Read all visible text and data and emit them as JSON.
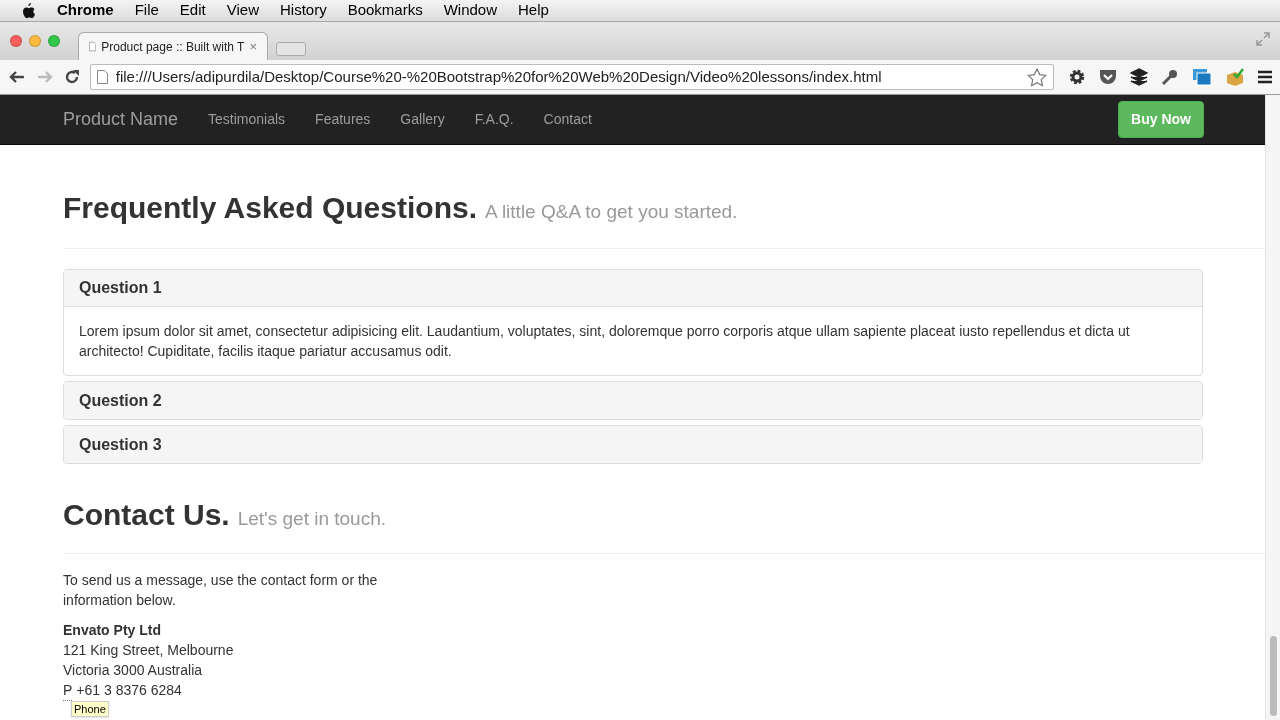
{
  "menu_bar": {
    "app": "Chrome",
    "items": [
      "File",
      "Edit",
      "View",
      "History",
      "Bookmarks",
      "Window",
      "Help"
    ]
  },
  "tabs": [
    {
      "title": "Product page :: Built with T",
      "selected": true,
      "close": "×"
    }
  ],
  "address_bar": {
    "value": "file:///Users/adipurdila/Desktop/Course%20-%20Bootstrap%20for%20Web%20Design/Video%20lessons/index.html"
  },
  "navbar": {
    "brand": "Product Name",
    "links": [
      "Testimonials",
      "Features",
      "Gallery",
      "F.A.Q.",
      "Contact"
    ],
    "cta": "Buy Now"
  },
  "faq": {
    "title": "Frequently Asked Questions.",
    "subtitle": "A little Q&A to get you started.",
    "panels": [
      {
        "question": "Question 1",
        "expanded": true,
        "answer": "Lorem ipsum dolor sit amet, consectetur adipisicing elit. Laudantium, voluptates, sint, doloremque porro corporis atque ullam sapiente placeat iusto repellendus et dicta ut architecto! Cupiditate, facilis itaque pariatur accusamus odit."
      },
      {
        "question": "Question 2",
        "expanded": false
      },
      {
        "question": "Question 3",
        "expanded": false
      }
    ]
  },
  "contact": {
    "title": "Contact Us.",
    "subtitle": "Let's get in touch.",
    "intro": "To send us a message, use the contact form or the information below.",
    "company": "Envato Pty Ltd",
    "address_lines": [
      "121 King Street, Melbourne",
      "Victoria 3000 Australia"
    ],
    "phone_abbr": "P",
    "phone": "+61 3 8376 6284",
    "tooltip": "Phone"
  }
}
